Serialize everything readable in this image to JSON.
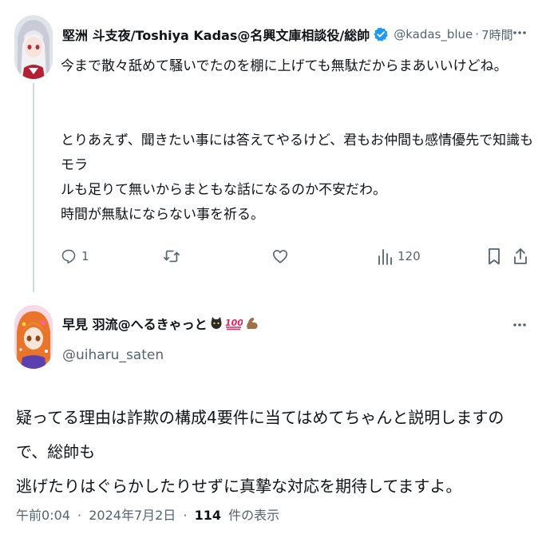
{
  "post1": {
    "display_name": "堅洲 斗支夜/Toshiya Kadas@名興文庫相談役/総帥",
    "handle": "@kadas_blue",
    "separator": "·",
    "time": "7時間",
    "verified_icon": "verified-badge-icon",
    "body_lines": [
      "今まで散々舐めて騒いでたのを棚に上げても無駄だからまあいいけどね。",
      "とりあえず、聞きたい事には答えてやるけど、君もお仲間も感情優先で知識もモラ",
      "ルも足りて無いからまともな話になるのか不安だわ。",
      "時間が無駄にならない事を祈る。"
    ],
    "actions": {
      "reply_count": "1",
      "retweet_count": "",
      "like_count": "",
      "views_count": "120"
    }
  },
  "post2": {
    "display_name": "早見 羽流@へるきゃっと",
    "handle": "@uiharu_saten",
    "name_emojis": [
      "cat-emoji",
      "hundred-points-emoji",
      "flexed-arm-emoji"
    ],
    "body_lines": [
      "疑ってる理由は詐欺の構成4要件に当てはめてちゃんと説明しますので、総帥も",
      "逃げたりはぐらかしたりせずに真摯な対応を期待してますよ。"
    ],
    "time": "午前0:04",
    "separator": "·",
    "date": "2024年7月2日",
    "views_count": "114",
    "views_label": "件の表示"
  },
  "colors": {
    "text_primary": "#0f1419",
    "text_secondary": "#536471",
    "verified_blue": "#1d9bf0",
    "thread_line": "#cfd9de"
  }
}
